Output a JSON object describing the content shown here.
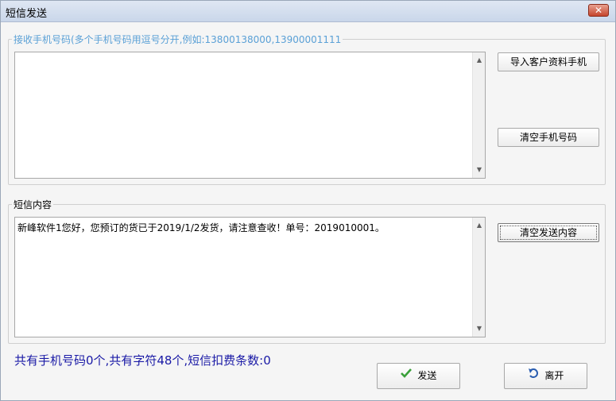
{
  "window": {
    "title": "短信发送",
    "close_symbol": "✕"
  },
  "recipients": {
    "group_label": "接收手机号码(多个手机号码用逗号分开,例如:13800138000,13900001111",
    "value": "",
    "import_button": "导入客户资料手机",
    "clear_button": "清空手机号码"
  },
  "message": {
    "group_label": "短信内容",
    "value": "新峰软件1您好，您预订的货已于2019/1/2发货，请注意查收！单号：2019010001。",
    "clear_button": "清空发送内容"
  },
  "status": "共有手机号码0个,共有字符48个,短信扣费条数:0",
  "actions": {
    "send_label": "发送",
    "leave_label": "离开"
  },
  "colors": {
    "group_label_accent": "#5aa0d6",
    "status_text": "#1a1aa6",
    "send_icon": "#3aa03a",
    "leave_icon": "#2a5db0"
  }
}
